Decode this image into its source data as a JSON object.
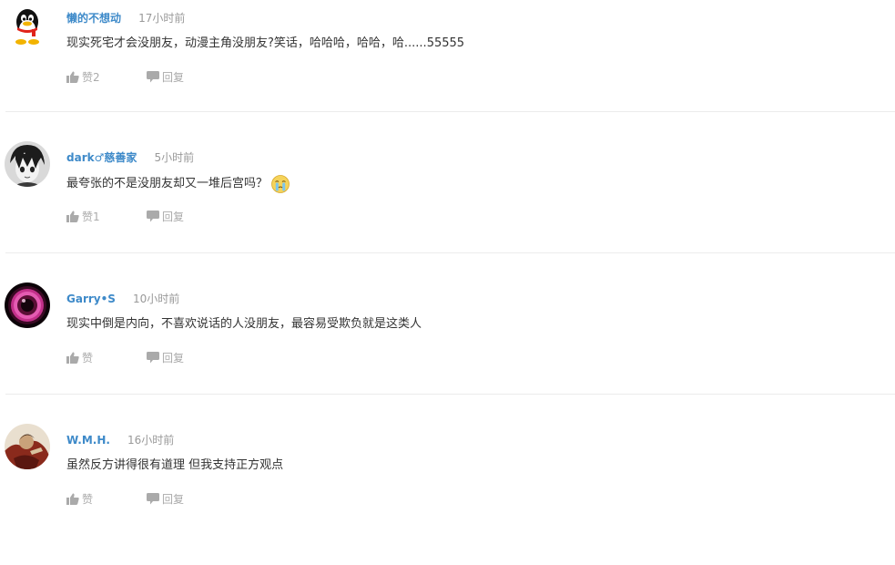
{
  "comments": [
    {
      "username": "懒的不想动",
      "time": "17小时前",
      "text": "现实死宅才会没朋友，动漫主角没朋友?笑话，哈哈哈，哈哈，哈......55555",
      "like_label": "赞2",
      "reply_label": "回复",
      "avatar_icon": "qq-penguin-icon"
    },
    {
      "username": "dark♂慈善家",
      "time": "5小时前",
      "text": "最夸张的不是没朋友却又一堆后宫吗？",
      "emoji_icon": "crying-face-icon",
      "like_label": "赞1",
      "reply_label": "回复",
      "avatar_icon": "anime-boy-avatar-icon"
    },
    {
      "username": "Garry•S",
      "time": "10小时前",
      "text": "现实中倒是内向，不喜欢说话的人没朋友，最容易受欺负就是这类人",
      "like_label": "赞",
      "reply_label": "回复",
      "avatar_icon": "pink-eye-avatar-icon"
    },
    {
      "username": "W.M.H.",
      "time": "16小时前",
      "text": "虽然反方讲得很有道理 但我支持正方观点",
      "like_label": "赞",
      "reply_label": "回复",
      "avatar_icon": "painted-figure-avatar-icon"
    }
  ],
  "colors": {
    "username": "#3e8ac9",
    "meta": "#999999",
    "text": "#333333",
    "action": "#aaaaaa",
    "divider": "#ececec"
  }
}
